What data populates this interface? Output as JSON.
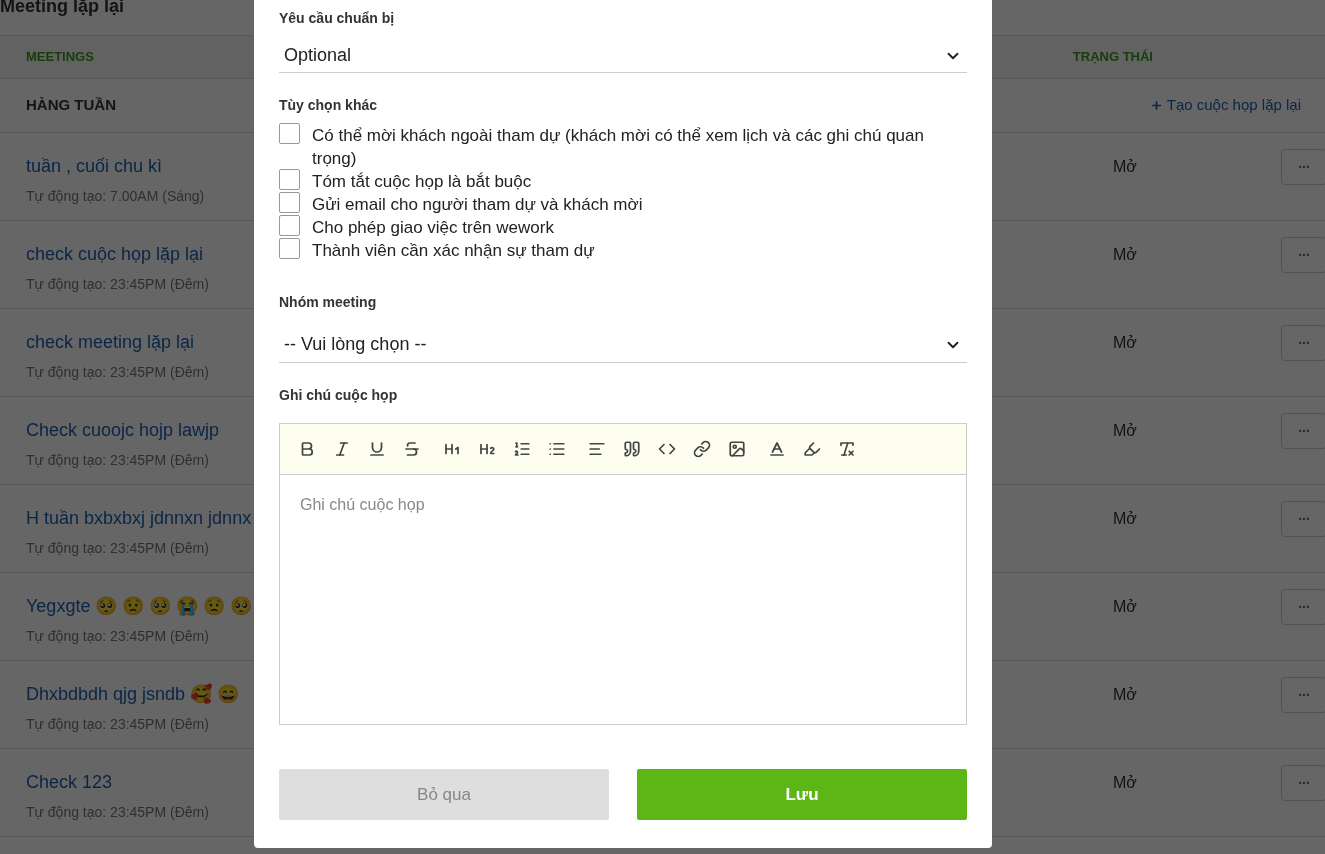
{
  "page": {
    "title": "Meeting lặp lại",
    "columns": [
      "MEETINGS",
      "TRẠNG THÁI"
    ],
    "group": "HÀNG TUẦN",
    "create_link": "Tạo cuộc họp lặp lại",
    "rows": [
      {
        "title": "tuần , cuối chu kì",
        "subtitle": "Tự động tạo: 7.00AM (Sáng)",
        "status": "Mở",
        "more": "..."
      },
      {
        "title": "check cuộc họp lặp lại",
        "subtitle": "Tự động tạo: 23:45PM (Đêm)",
        "status": "Mở",
        "more": "..."
      },
      {
        "title": "check meeting lặp lại",
        "subtitle": "Tự động tạo: 23:45PM (Đêm)",
        "status": "Mở",
        "more": "..."
      },
      {
        "title": "Check cuoojc hojp lawjp",
        "subtitle": "Tự động tạo: 23:45PM (Đêm)",
        "status": "Mở",
        "more": "..."
      },
      {
        "title": "H tuần bxbxbxj jdnnxn jdnnx",
        "subtitle": "Tự động tạo: 23:45PM (Đêm)",
        "status": "Mở",
        "more": "..."
      },
      {
        "title": "Yegxgte 🥺 😟 🥺 😭 😟 🥺",
        "subtitle": "Tự động tạo: 23:45PM (Đêm)",
        "status": "Mở",
        "more": "..."
      },
      {
        "title": "Dhxbdbdh qjg jsndb 🥰 😄",
        "subtitle": "Tự động tạo: 23:45PM (Đêm)",
        "status": "Mở",
        "more": "..."
      },
      {
        "title": "Check 123",
        "subtitle": "Tự động tạo: 23:45PM (Đêm)",
        "status": "Mở",
        "more": "..."
      }
    ]
  },
  "dialog": {
    "prep": {
      "label": "Yêu cầu chuẩn bị",
      "value": "Optional"
    },
    "options_label": "Tùy chọn khác",
    "options": [
      {
        "label": "Có thể mời khách ngoài tham dự (khách mời có thể xem lịch và các ghi chú quan trọng)",
        "checked": false
      },
      {
        "label": "Tóm tắt cuộc họp là bắt buộc",
        "checked": false
      },
      {
        "label": "Gửi email cho người tham dự và khách mời",
        "checked": false
      },
      {
        "label": "Cho phép giao việc trên wework",
        "checked": false
      },
      {
        "label": "Thành viên cần xác nhận sự tham dự",
        "checked": false
      }
    ],
    "group": {
      "label": "Nhóm meeting",
      "value": "-- Vui lòng chọn --"
    },
    "notes": {
      "label": "Ghi chú cuộc họp",
      "placeholder": "Ghi chú cuộc họp"
    },
    "cancel": "Bỏ qua",
    "save": "Lưu"
  }
}
